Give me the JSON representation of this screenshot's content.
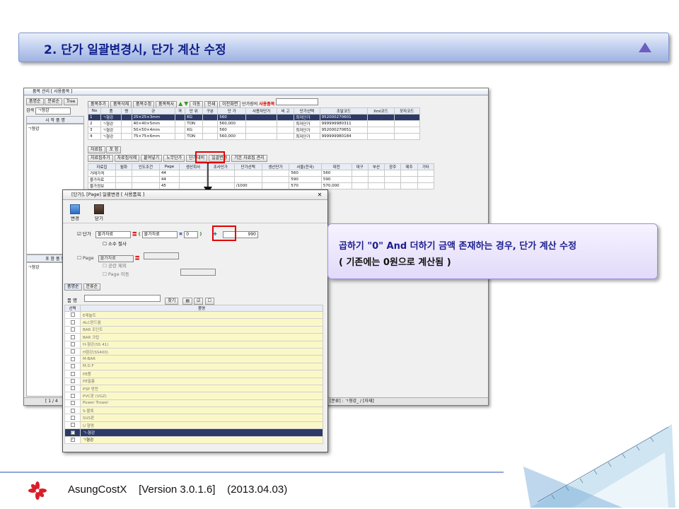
{
  "slide": {
    "title": "2. 단가 일괄변경시, 단가 계산 수정",
    "callout_line1": "곱하기 \"0\" And 더하기 금액 존재하는 경우, 단가 계산 수정",
    "callout_line2": "( 기존에는 0원으로 계산됨 )",
    "footer_app": "AsungCostX",
    "footer_version": "[Version 3.0.1.6]",
    "footer_date": "(2013.04.03)"
  },
  "mainwin": {
    "title": "품목 관리 [ 사용품목 ]",
    "left_tabs": [
      "품명순",
      "분류순",
      "Tree"
    ],
    "search_label": "검색",
    "search_value": "ㄱ형강",
    "left_header": "시 작 품 명",
    "left_item": "ㄱ형강",
    "left_header2": "포 함 품 명",
    "left_item2": "ㄱ형강",
    "toolbar": [
      "품목추가",
      "품목삭제",
      "품목수정",
      "품목복사",
      "이동",
      "인쇄",
      "이전화면"
    ],
    "check_label": "단가장의",
    "usage_label": "사용품목",
    "grid_headers": [
      "No",
      "품",
      "명",
      "규",
      "격",
      "단 위",
      "구분",
      "단 가",
      "사용자단가",
      "비 고",
      "단가선택",
      "조달코드",
      "Xml코드",
      "모자코드"
    ],
    "grid_rows": [
      [
        "1",
        "ㄱ형강",
        "",
        "25×25×3mm",
        "",
        "KG",
        "",
        "560",
        "",
        "",
        "최저단가",
        "952000270601",
        "",
        ""
      ],
      [
        "2",
        "ㄱ형강",
        "",
        "40×40×5mm",
        "",
        "TON",
        "",
        "560,000",
        "",
        "",
        "최저단가",
        "999999980311",
        "",
        ""
      ],
      [
        "3",
        "ㄱ형강",
        "",
        "50×50×4mm",
        "",
        "KG",
        "",
        "560",
        "",
        "",
        "최저단가",
        "952000270651",
        "",
        ""
      ],
      [
        "4",
        "ㄱ형강",
        "",
        "75×75×6mm",
        "",
        "TON",
        "",
        "560,000",
        "",
        "",
        "최저단가",
        "999999980184",
        "",
        ""
      ]
    ],
    "sub_tabs": [
      "자료집",
      "포 함"
    ],
    "sub_toolbar": [
      "자료집추가",
      "자료집삭제",
      "붙여넣기",
      "노무단가",
      "단가대비",
      "일괄변경",
      "기본 자료집 관리"
    ],
    "sub_headers": [
      "자료집",
      "월화",
      "인도조건",
      "Page",
      "생산회사",
      "조사단가",
      "단가선택",
      "생산단가",
      "서울(전국)",
      "대전",
      "대구",
      "부산",
      "광주",
      "제주",
      "기타"
    ],
    "sub_rows": [
      [
        "거래가격",
        "",
        "",
        "44",
        "",
        "",
        "",
        "",
        "560",
        "560",
        "",
        "",
        "",
        "",
        ""
      ],
      [
        "물가자료",
        "",
        "",
        "44",
        "",
        "",
        "",
        "",
        "590",
        "590",
        "",
        "",
        "",
        "",
        ""
      ],
      [
        "물가정보",
        "",
        "",
        "45",
        "",
        "",
        "/1000",
        "",
        "570",
        "570,000",
        "",
        "",
        "",
        "",
        ""
      ]
    ],
    "status_left": "[ 1 / 4",
    "status_right": "[분류] : ㄱ형강_ / [자재]"
  },
  "dialog": {
    "title": "[단가], [Page] 일괄변경 [ 사용품목 ]",
    "tool_change": "변경",
    "tool_close": "닫기",
    "price_label": "단가",
    "combo_left": "물가자료",
    "combo_right": "물가자료",
    "multiply_value": "0",
    "add_value": "990",
    "decimal_label": "소수 절사",
    "page_label": "Page",
    "page_combo": "물가자료",
    "page_check1": "공란 제외",
    "page_check2": "Page 이동",
    "tabs": [
      "품명순",
      "분류순"
    ],
    "name_label": "품 명",
    "find_button": "찾기",
    "list_headers": [
      "선택",
      "품명"
    ],
    "items": [
      "E래뉼트",
      "ALC판드월",
      "BAR 조인트",
      "BAR 크립",
      "H-형강(SS 41)",
      "H형강(SS400)",
      "M-BAR",
      "M.D.F",
      "PE품",
      "PE필름",
      "PSP 방찬",
      "PVC판 (VGZ)",
      "Power Trowel",
      "S-볼록",
      "SUS판",
      "U 형명",
      "ㄱ-형강",
      "ㄱ형강"
    ]
  },
  "colors": {
    "accent": "#10208a",
    "highlight": "#e00000",
    "selection": "#2b3a67"
  }
}
